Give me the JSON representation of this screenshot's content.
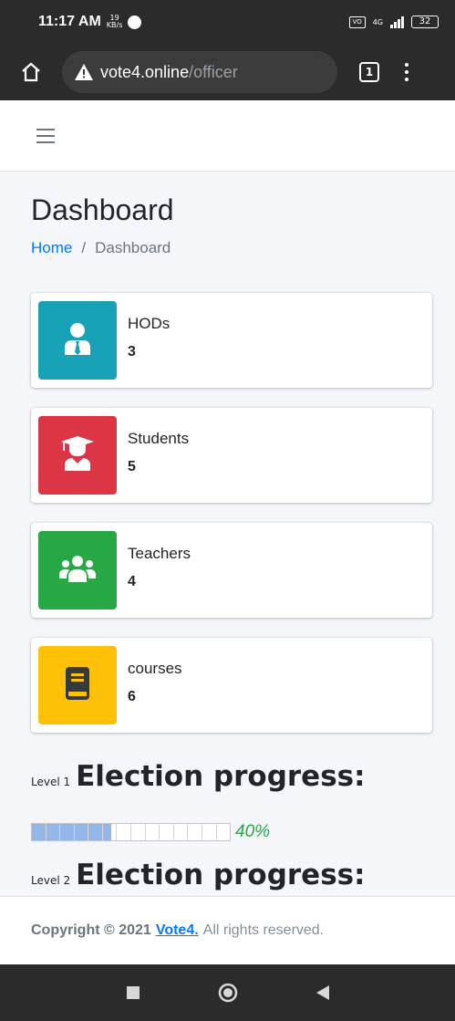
{
  "status_bar": {
    "time": "11:17 AM",
    "speed_value": "19",
    "speed_unit": "KB/s",
    "volte": "VO",
    "network": "4G",
    "battery": "32"
  },
  "browser": {
    "url_domain": "vote4.online",
    "url_path": "/officer",
    "tab_count": "1"
  },
  "page": {
    "title": "Dashboard",
    "breadcrumb": {
      "home": "Home",
      "separator": "/",
      "current": "Dashboard"
    }
  },
  "stats": [
    {
      "label": "HODs",
      "value": "3",
      "color": "#17a2b8",
      "icon": "user-tie-icon"
    },
    {
      "label": "Students",
      "value": "5",
      "color": "#dc3545",
      "icon": "graduate-icon"
    },
    {
      "label": "Teachers",
      "value": "4",
      "color": "#28a745",
      "icon": "users-icon"
    },
    {
      "label": "courses",
      "value": "6",
      "color": "#ffc107",
      "icon": "book-icon"
    }
  ],
  "election": {
    "level1": {
      "level_label": "Level 1",
      "title": "Election progress:",
      "progress": 0.4,
      "progress_text": "40%"
    },
    "level2": {
      "level_label": "Level 2",
      "title": "Election progress:"
    }
  },
  "footer": {
    "copyright": "Copyright © 2021",
    "brand": "Vote4.",
    "rest": "All rights reserved."
  },
  "colors": {
    "link": "#007bff",
    "progress_fill": "#92b7e8",
    "progress_text": "#28a745"
  }
}
